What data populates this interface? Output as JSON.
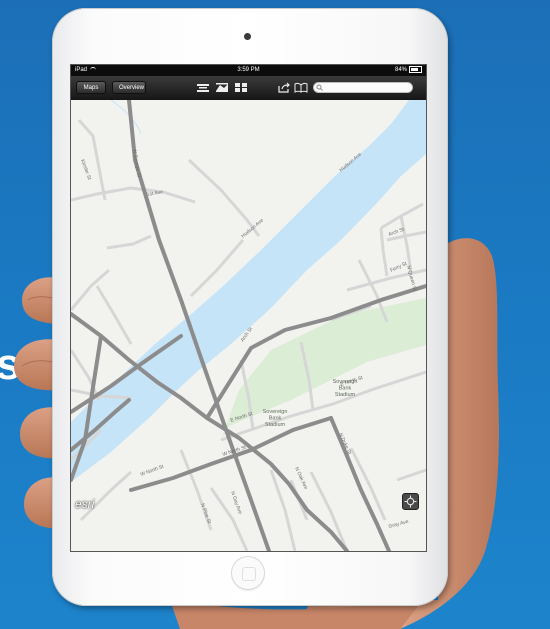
{
  "slide": {
    "visible_text": "s"
  },
  "status_bar": {
    "device": "iPad",
    "time": "3:59 PM",
    "battery": "84%"
  },
  "toolbar": {
    "maps_label": "Maps",
    "overview_label": "Overview",
    "search_placeholder": ""
  },
  "map": {
    "attribution_logo": "esri",
    "park_label": "Sovereign Bank Stadium",
    "park_label_lines": [
      "Sovereign",
      "Bank",
      "Stadium"
    ],
    "park_label_2_lines": [
      "Sovereign",
      "Bank",
      "Stadium"
    ],
    "streets": {
      "hudson_ave": "Hudson Ave",
      "first_ave": "1st Ave",
      "n_george_st": "N George St",
      "arch_st": "Arch St",
      "e_north_st": "E North St",
      "n_beaver_st": "N Beaver St",
      "w_north_st": "W North St",
      "n_duke_st": "N Duke St",
      "n_queen_st": "N Queen St",
      "n_gay_ave": "N Gay Ave",
      "n_pine_st": "N Pine St",
      "lincoln_st": "Linc St",
      "gray_ave": "Gray Ave",
      "n_oak_ave": "N Oak Ave",
      "ferry_st": "Ferry St",
      "left_street": "Kinsler St"
    },
    "colors": {
      "land": "#f2f2ef",
      "water": "#c6e4f8",
      "park": "#dcedd6",
      "major_road": "#8c8c8c",
      "minor_road": "#d6d6d6"
    }
  }
}
